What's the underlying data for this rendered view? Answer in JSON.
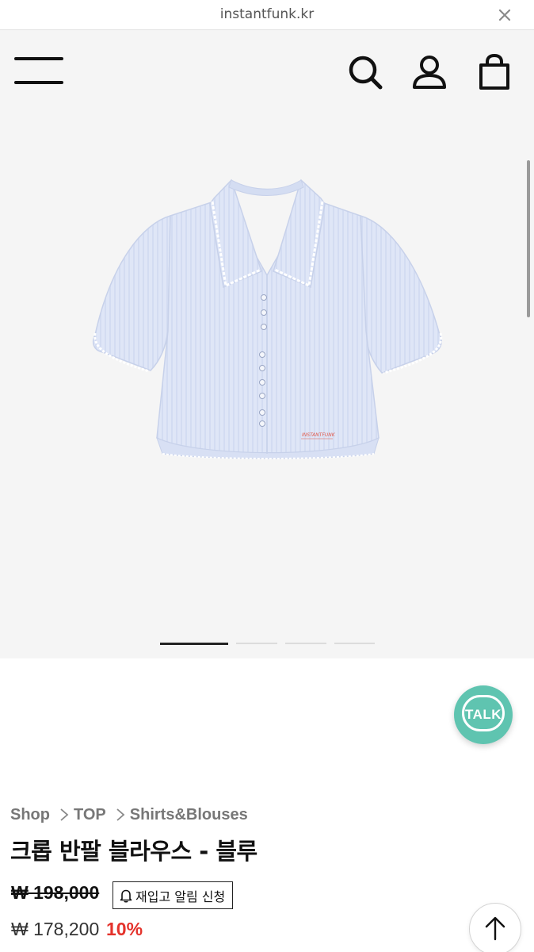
{
  "browser": {
    "url": "instantfunk.kr",
    "close_icon": "close-icon"
  },
  "header": {
    "menu_icon": "hamburger-menu-icon",
    "search_icon": "search-icon",
    "account_icon": "user-icon",
    "cart_icon": "shopping-bag-icon"
  },
  "gallery": {
    "image_alt": "product-photo-light-blue-crop-blouse",
    "slide_count": 4,
    "active_slide": 1,
    "product_label_text": "INSTANTFUNK"
  },
  "chat": {
    "label": "TALK",
    "color": "#5fc4b0"
  },
  "breadcrumb": {
    "items": [
      "Shop",
      "TOP",
      "Shirts&Blouses"
    ]
  },
  "product": {
    "name": "크롭 반팔 블라우스 - 블루",
    "original_price": "₩ 198,000",
    "restock_label": "재입고 알림 신청",
    "sale_price": "₩ 178,200",
    "discount": "10%",
    "discount_color": "#e4322b"
  },
  "scroll_top": {
    "icon": "arrow-up-icon"
  }
}
